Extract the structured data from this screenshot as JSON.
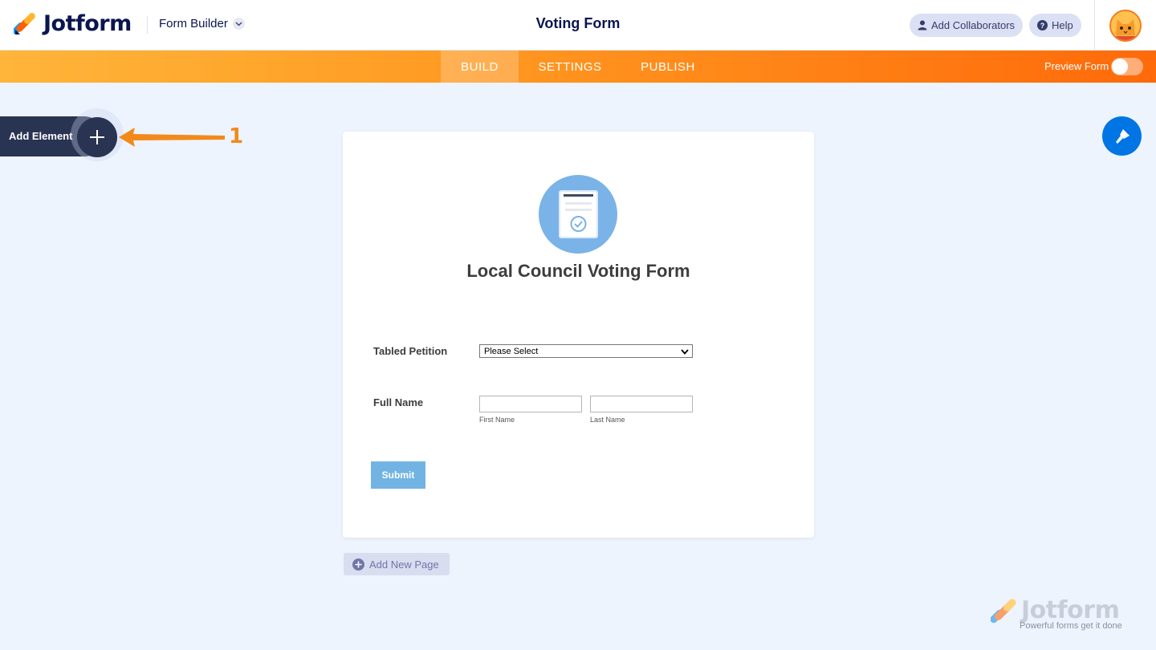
{
  "header": {
    "brand": "Jotform",
    "builder_dropdown": "Form Builder",
    "title": "Voting Form",
    "add_collaborators": "Add Collaborators",
    "help": "Help"
  },
  "nav": {
    "tabs": [
      {
        "label": "BUILD",
        "active": true
      },
      {
        "label": "SETTINGS",
        "active": false
      },
      {
        "label": "PUBLISH",
        "active": false
      }
    ],
    "preview_label": "Preview Form",
    "preview_enabled": false
  },
  "sidebar": {
    "add_element_label": "Add Element"
  },
  "annotation": {
    "callout_number": "1",
    "callout_color": "#f28a1b"
  },
  "form": {
    "heading": "Local Council Voting Form",
    "fields": [
      {
        "label": "Tabled Petition",
        "type": "select",
        "value": "Please Select"
      },
      {
        "label": "Full Name",
        "type": "name",
        "sublabels": [
          "First Name",
          "Last Name"
        ]
      }
    ],
    "submit_label": "Submit"
  },
  "footer": {
    "add_page": "Add New Page",
    "watermark_brand": "Jotform",
    "watermark_tagline": "Powerful forms get it done"
  },
  "colors": {
    "accent_orange": "#ff7e14",
    "navy": "#0a1551",
    "designer_blue": "#0075e3",
    "submit_blue": "#71b4e3"
  }
}
